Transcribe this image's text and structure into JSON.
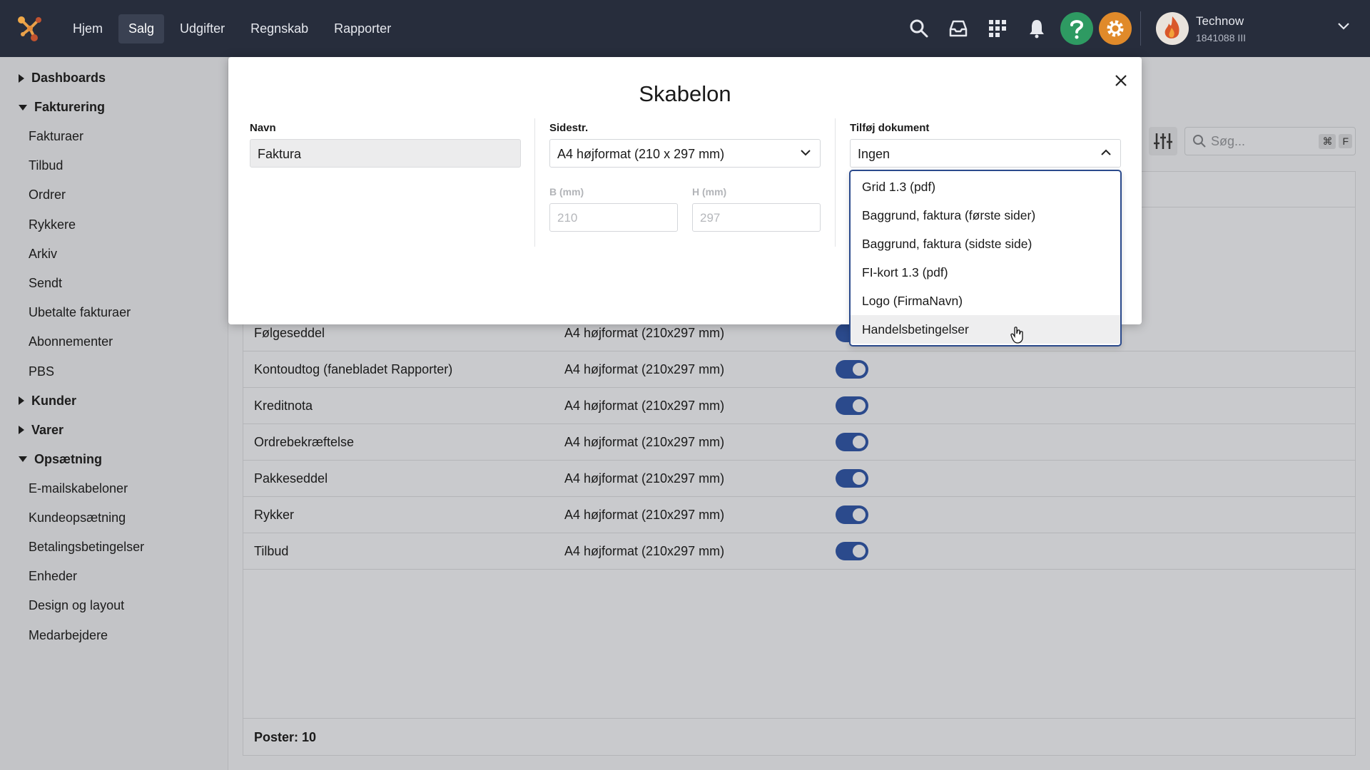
{
  "topbar": {
    "nav": [
      "Hjem",
      "Salg",
      "Udgifter",
      "Regnskab",
      "Rapporter"
    ],
    "active_nav": "Salg",
    "icons": [
      "search-icon",
      "inbox-icon",
      "apps-grid-icon",
      "bell-icon",
      "help-icon",
      "settings-icon"
    ],
    "help_color": "#2e9a62",
    "settings_color": "#e08a2a",
    "user": {
      "name": "Technow",
      "id": "1841088 III"
    }
  },
  "sidebar": {
    "groups": [
      {
        "label": "Dashboards",
        "expanded": false,
        "items": []
      },
      {
        "label": "Fakturering",
        "expanded": true,
        "items": [
          "Fakturaer",
          "Tilbud",
          "Ordrer",
          "Rykkere",
          "Arkiv",
          "Sendt",
          "Ubetalte fakturaer",
          "Abonnementer",
          "PBS"
        ]
      },
      {
        "label": "Kunder",
        "expanded": false,
        "items": []
      },
      {
        "label": "Varer",
        "expanded": false,
        "items": []
      },
      {
        "label": "Opsætning",
        "expanded": true,
        "items": [
          "E-mailskabeloner",
          "Kundeopsætning",
          "Betalingsbetingelser",
          "Enheder",
          "Design og layout",
          "Medarbejdere"
        ]
      }
    ]
  },
  "main": {
    "search_placeholder": "Søg...",
    "shortcut": [
      "⌘",
      "F"
    ],
    "rows": [
      {
        "name": "Følgeseddel",
        "format": "A4 højformat (210x297 mm)",
        "active": true
      },
      {
        "name": "Kontoudtog (fanebladet Rapporter)",
        "format": "A4 højformat (210x297 mm)",
        "active": true
      },
      {
        "name": "Kreditnota",
        "format": "A4 højformat (210x297 mm)",
        "active": true
      },
      {
        "name": "Ordrebekræftelse",
        "format": "A4 højformat (210x297 mm)",
        "active": true
      },
      {
        "name": "Pakkeseddel",
        "format": "A4 højformat (210x297 mm)",
        "active": true
      },
      {
        "name": "Rykker",
        "format": "A4 højformat (210x297 mm)",
        "active": true
      },
      {
        "name": "Tilbud",
        "format": "A4 højformat (210x297 mm)",
        "active": true
      }
    ],
    "footer": "Poster: 10"
  },
  "modal": {
    "title": "Skabelon",
    "name_label": "Navn",
    "name_value": "Faktura",
    "size_label": "Sidestr.",
    "size_value": "A4 højformat (210 x 297 mm)",
    "width_label": "B (mm)",
    "width_placeholder": "210",
    "height_label": "H (mm)",
    "height_placeholder": "297",
    "doc_label": "Tilføj dokument",
    "doc_value": "Ingen",
    "doc_options": [
      "Grid 1.3 (pdf)",
      "Baggrund, faktura (første sider)",
      "Baggrund, faktura (sidste side)",
      "FI-kort 1.3 (pdf)",
      "Logo (FirmaNavn)",
      "Handelsbetingelser"
    ],
    "hovered_option": "Handelsbetingelser"
  },
  "colors": {
    "accent": "#2b4a8c",
    "topbar": "#272d3c"
  }
}
